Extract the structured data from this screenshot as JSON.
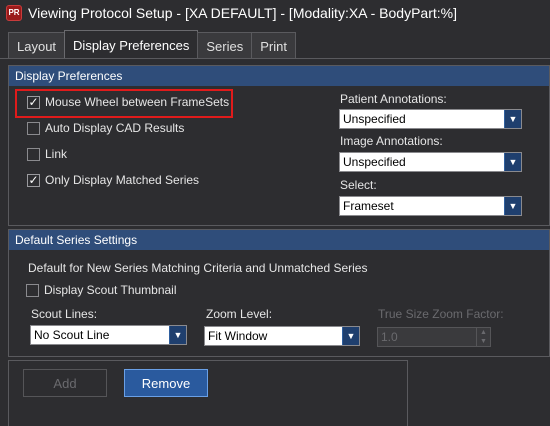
{
  "window": {
    "icon_text": "PR",
    "title": "Viewing Protocol Setup - [XA DEFAULT] - [Modality:XA - BodyPart:%]"
  },
  "tabs": [
    {
      "label": "Layout",
      "active": false
    },
    {
      "label": "Display Preferences",
      "active": true
    },
    {
      "label": "Series",
      "active": false
    },
    {
      "label": "Print",
      "active": false
    }
  ],
  "display_preferences": {
    "header": "Display Preferences",
    "options": [
      {
        "label": "Mouse Wheel between FrameSets",
        "checked": true
      },
      {
        "label": "Auto Display CAD Results",
        "checked": false
      },
      {
        "label": "Link",
        "checked": false
      },
      {
        "label": "Only Display Matched Series",
        "checked": true
      }
    ],
    "patient_annotations": {
      "label": "Patient Annotations:",
      "value": "Unspecified"
    },
    "image_annotations": {
      "label": "Image Annotations:",
      "value": "Unspecified"
    },
    "select": {
      "label": "Select:",
      "value": "Frameset"
    }
  },
  "default_series": {
    "header": "Default Series Settings",
    "description": "Default for New Series Matching Criteria and Unmatched Series",
    "display_scout_thumbnail": {
      "label": "Display Scout Thumbnail",
      "checked": false
    },
    "scout_lines": {
      "label": "Scout Lines:",
      "value": "No Scout Line"
    },
    "zoom_level": {
      "label": "Zoom Level:",
      "value": "Fit Window"
    },
    "true_size_zoom": {
      "label": "True Size Zoom Factor:",
      "value": "1.0"
    }
  },
  "buttons": {
    "add": "Add",
    "remove": "Remove"
  },
  "colors": {
    "section_header": "#2f4d7a",
    "highlight": "#e01b1b",
    "primary_button": "#2a5a9e"
  }
}
